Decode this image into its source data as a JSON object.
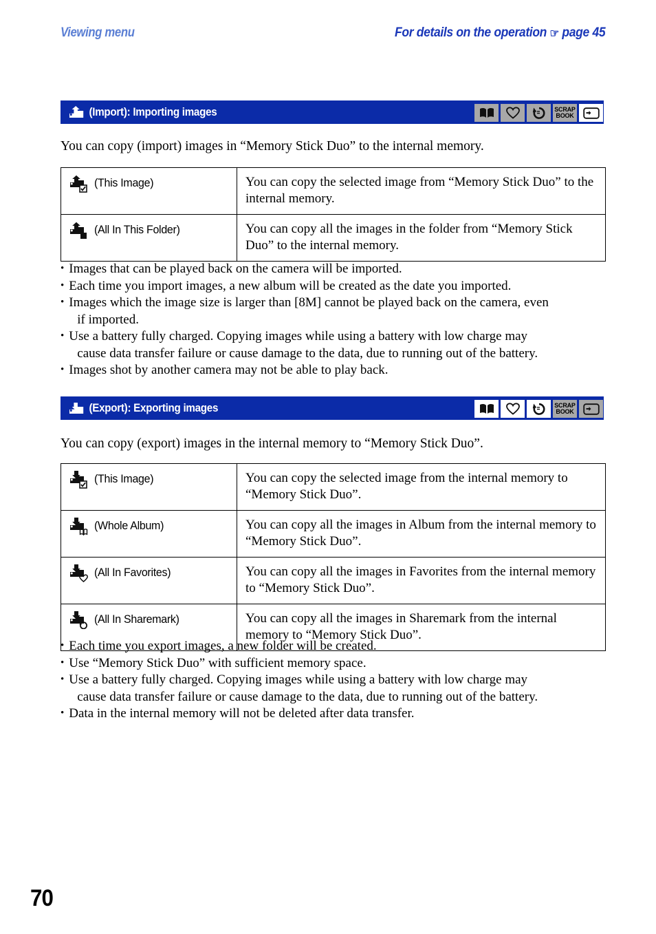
{
  "header": {
    "left_title": "Viewing menu",
    "right_title_pre": "For details on the operation",
    "right_title_post": "page 45",
    "pointer_icon": "pointing-hand-icon"
  },
  "page_number": "70",
  "mode_icons": {
    "album": "open-book-icon",
    "favorites": "heart-icon",
    "sharemark": "circular-arrow-icon",
    "scrapbook_line1": "SCRAP",
    "scrapbook_line2": "BOOK",
    "tag": "tag-icon"
  },
  "sections": [
    {
      "id": "import",
      "banner_icon": "import-card-up-arrow-icon",
      "banner_title": "(Import): Importing images",
      "mode_states": [
        "gray",
        "gray",
        "gray",
        "gray",
        "white"
      ],
      "intro": "You can copy (import) images in “Memory Stick Duo” to the internal memory.",
      "rows": [
        {
          "icon": "import-this-image-icon",
          "label": "(This Image)",
          "desc": "You can copy the selected image from “Memory Stick Duo” to the internal memory."
        },
        {
          "icon": "import-all-in-folder-icon",
          "label": "(All In This Folder)",
          "desc": "You can copy all the images in the folder from “Memory Stick Duo” to the internal memory."
        }
      ],
      "notes": [
        {
          "line1": "Images that can be played back on the camera will be imported.",
          "line2": ""
        },
        {
          "line1": "Each time you import images, a new album will be created as the date you imported.",
          "line2": ""
        },
        {
          "line1": "Images which the image size is larger than [8M] cannot be played back on the camera, even",
          "line2": "if imported."
        },
        {
          "line1": "Use a battery fully charged. Copying images while using a battery with low charge may",
          "line2": "cause data transfer failure or cause damage to the data, due to running out of the battery."
        },
        {
          "line1": "Images shot by another camera may not be able to play back.",
          "line2": ""
        }
      ]
    },
    {
      "id": "export",
      "banner_icon": "export-card-down-arrow-icon",
      "banner_title": "(Export): Exporting images",
      "mode_states": [
        "white",
        "white",
        "white",
        "gray",
        "gray"
      ],
      "intro": "You can copy (export) images in the internal memory to “Memory Stick Duo”.",
      "rows": [
        {
          "icon": "export-this-image-icon",
          "label": "(This Image)",
          "desc": "You can copy the selected image from the internal memory to “Memory Stick Duo”."
        },
        {
          "icon": "export-whole-album-icon",
          "label": "(Whole Album)",
          "desc": "You can copy all the images in Album from the internal memory to “Memory Stick Duo”."
        },
        {
          "icon": "export-all-in-favorites-icon",
          "label": "(All In Favorites)",
          "desc": "You can copy all the images in Favorites from the internal memory to “Memory Stick Duo”."
        },
        {
          "icon": "export-all-in-sharemark-icon",
          "label": "(All In Sharemark)",
          "desc": "You can copy all the images in Sharemark from the internal memory to “Memory Stick Duo”."
        }
      ],
      "notes": [
        {
          "line1": "Each time you export images, a new folder will be created.",
          "line2": ""
        },
        {
          "line1": "Use “Memory Stick Duo” with sufficient memory space.",
          "line2": ""
        },
        {
          "line1": "Use a battery fully charged. Copying images while using a battery with low charge may",
          "line2": "cause data transfer failure or cause damage to the data, due to running out of the battery."
        },
        {
          "line1": "Data in the internal memory will not be deleted after data transfer.",
          "line2": ""
        }
      ]
    }
  ],
  "colors": {
    "banner_bg": "#0b2ba8",
    "header_left": "#5b7fd4",
    "header_right": "#1a37b8",
    "icon_gray": "#a8a8a8"
  }
}
